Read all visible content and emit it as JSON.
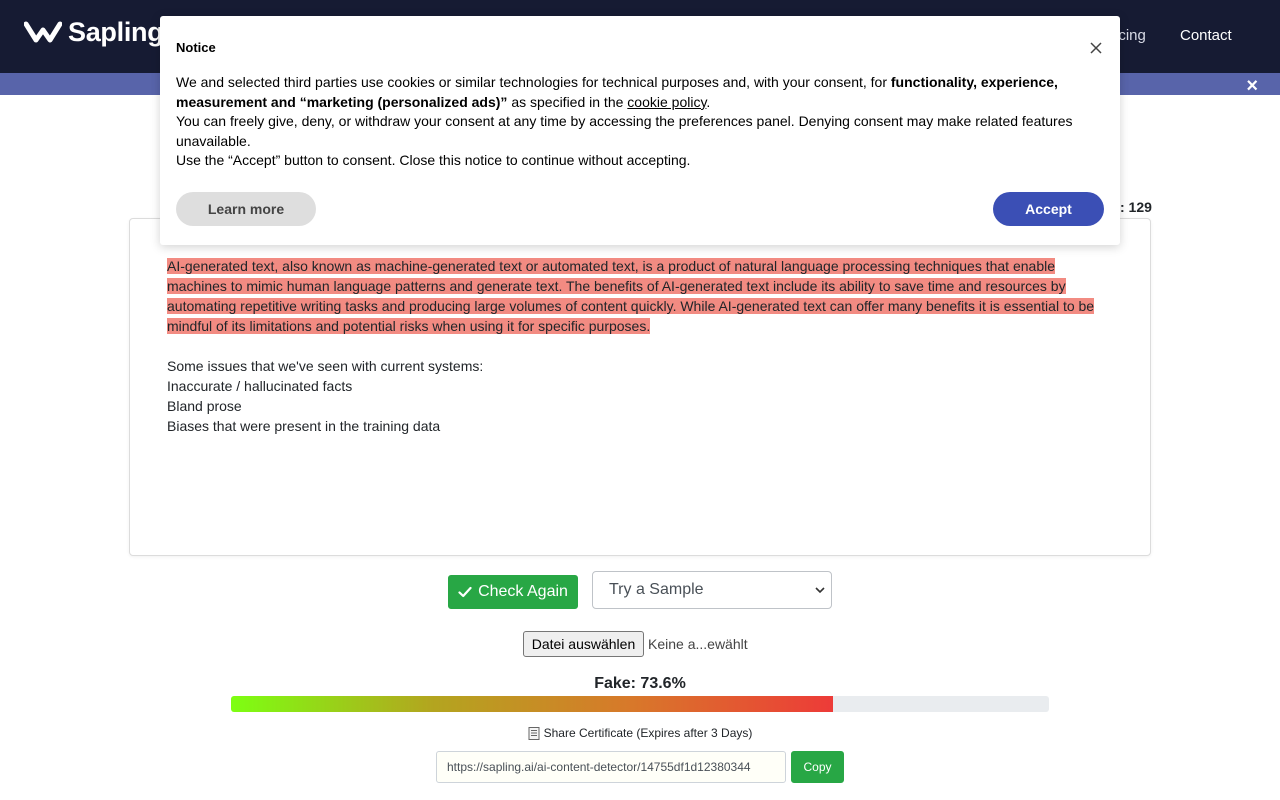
{
  "header": {
    "logo_text": "Sapling",
    "nav": {
      "pricing": "Pricing",
      "contact": "Contact"
    },
    "banner_close": "×",
    "colors": {
      "nav_bg": "#161b33",
      "banner_bg": "#5864aa"
    }
  },
  "detector": {
    "char_count_fragment": ": 129",
    "highlighted_text": "AI-generated text, also known as machine-generated text or automated text, is a product of natural language processing techniques that enable machines to mimic human language patterns and generate text. The benefits of AI-generated text include its ability to save time and resources by automating repetitive writing tasks and producing large volumes of content quickly. While AI-generated text can offer many benefits it is essential to be mindful of its limitations and potential risks when using it for specific purposes.",
    "plain_lines": [
      "Some issues that we've seen with current systems:",
      "Inaccurate / hallucinated facts",
      "Bland prose",
      "Biases that were present in the training data"
    ],
    "check_again_label": "Check Again",
    "sample_select_value": "Try a Sample",
    "file_button_label": "Datei auswählen",
    "file_status": "Keine a...ewählt",
    "fake_label": "Fake: 73.6%",
    "fake_fraction": 0.736,
    "share_label": "Share Certificate (Expires after 3 Days)",
    "share_url": "https://sapling.ai/ai-content-detector/14755df1d12380344",
    "copy_label": "Copy",
    "colors": {
      "highlight": "#f28b82",
      "success": "#28a745"
    }
  },
  "notice": {
    "title": "Notice",
    "line1_pre": "We and selected third parties use cookies or similar technologies for technical purposes and, with your consent, for ",
    "line1_bold": "functionality, experience, measurement and “marketing (personalized ads)”",
    "line1_mid": " as specified in the ",
    "line1_link": "cookie policy",
    "line1_end": ".",
    "line2": "You can freely give, deny, or withdraw your consent at any time by accessing the preferences panel. Denying consent may make related features unavailable.",
    "line3": "Use the “Accept” button to consent. Close this notice to continue without accepting.",
    "learn_more": "Learn more",
    "accept": "Accept",
    "colors": {
      "accept_bg": "#3b4fb5"
    }
  }
}
